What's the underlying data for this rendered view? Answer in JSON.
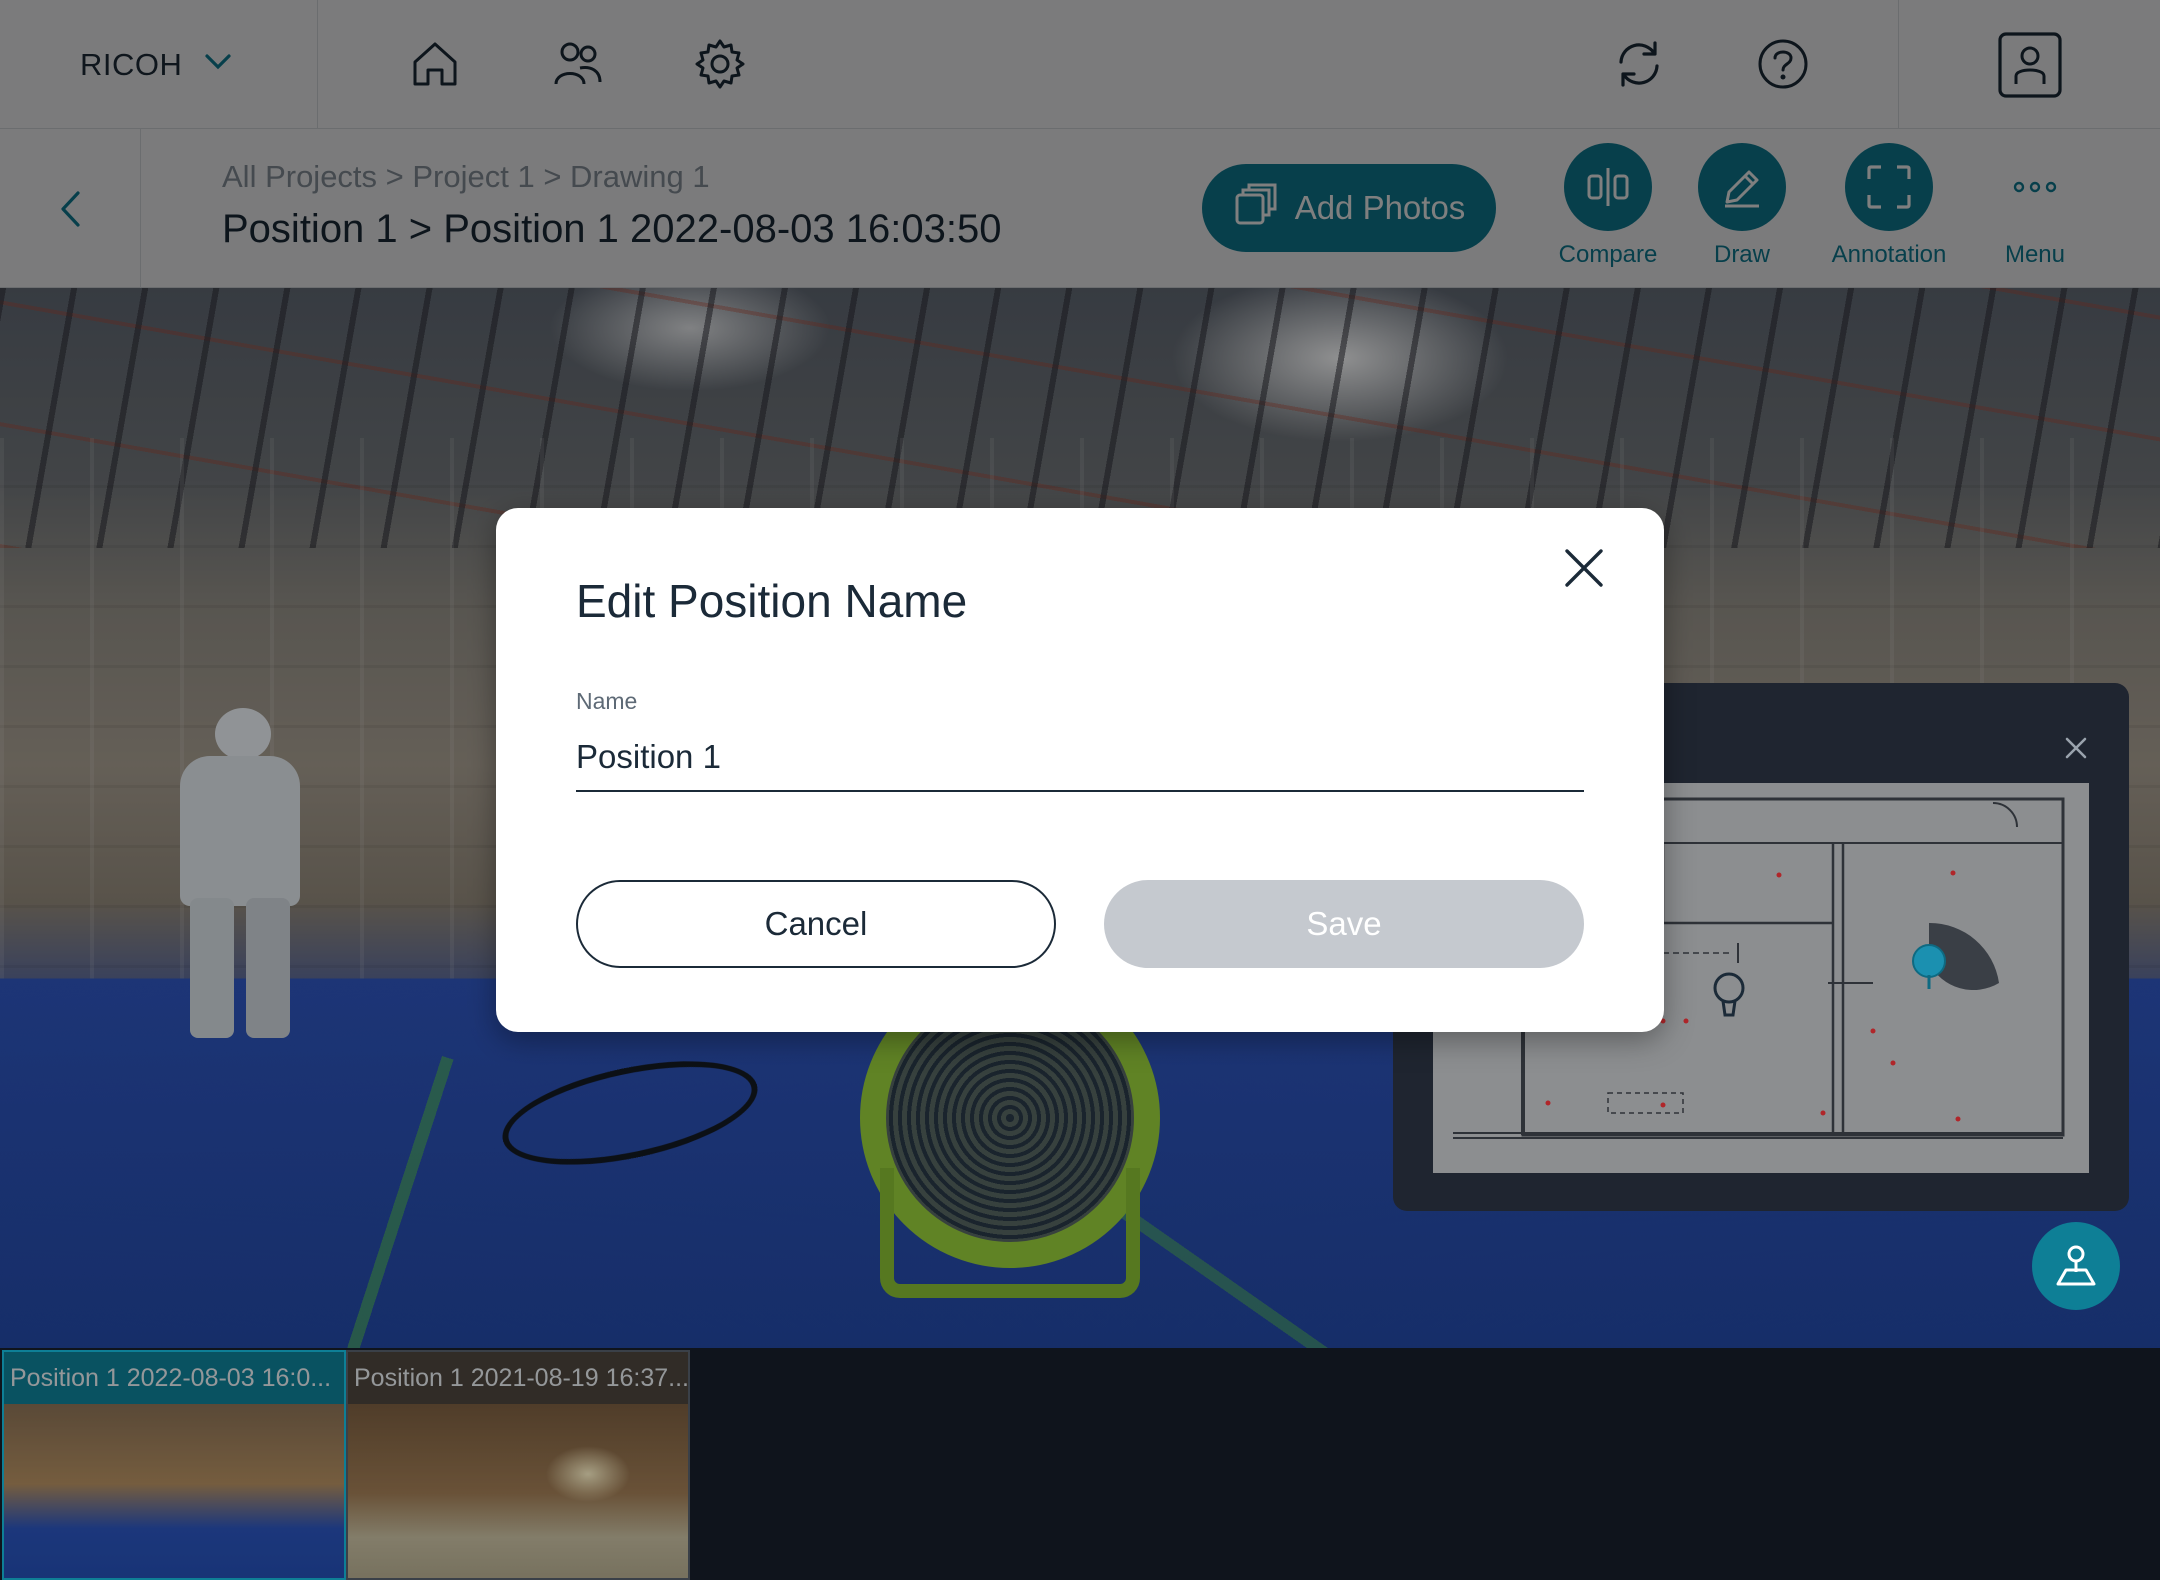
{
  "brand": {
    "name": "RICOH"
  },
  "nav": {
    "icons": [
      "home-icon",
      "users-icon",
      "settings-icon",
      "sync-icon",
      "help-icon",
      "account-icon"
    ]
  },
  "header": {
    "breadcrumb": "All Projects > Project 1 > Drawing 1",
    "title": "Position 1 > Position 1 2022-08-03 16:03:50",
    "add_photos_label": "Add Photos",
    "tools": {
      "compare": "Compare",
      "draw": "Draw",
      "annotation": "Annotation",
      "menu": "Menu"
    }
  },
  "thumbnails": [
    {
      "caption": "Position 1 2022-08-03 16:0...",
      "selected": true
    },
    {
      "caption": "Position 1 2021-08-19 16:37...",
      "selected": false
    }
  ],
  "modal": {
    "title": "Edit Position Name",
    "field_label": "Name",
    "field_value": "Position 1",
    "cancel_label": "Cancel",
    "save_label": "Save"
  },
  "colors": {
    "accent": "#0e7f96",
    "text": "#1b2a38",
    "disabled_button": "#c5c9cf"
  }
}
